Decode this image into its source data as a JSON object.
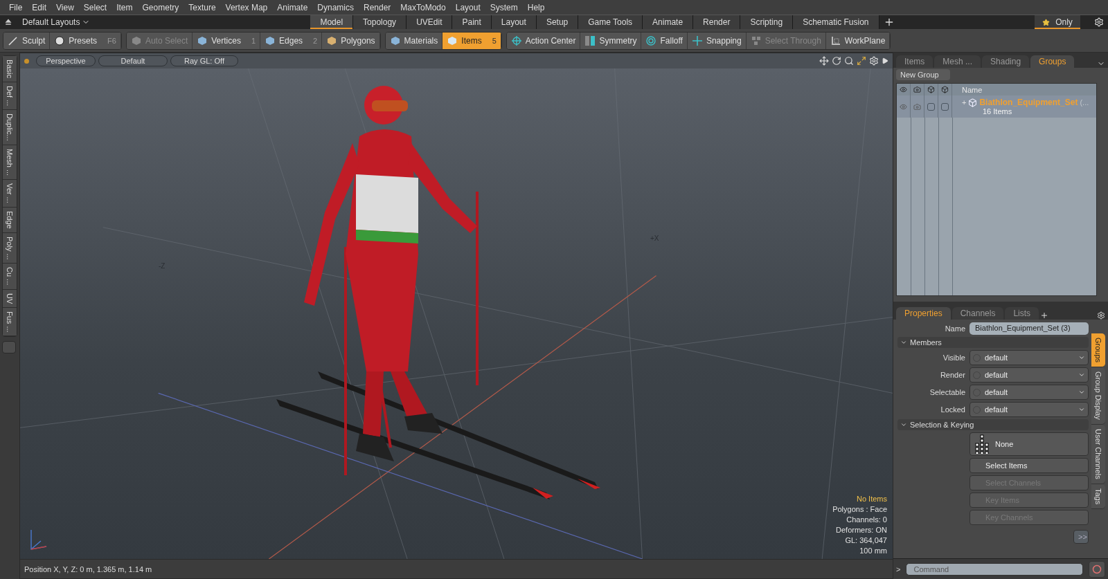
{
  "menu": [
    "File",
    "Edit",
    "View",
    "Select",
    "Item",
    "Geometry",
    "Texture",
    "Vertex Map",
    "Animate",
    "Dynamics",
    "Render",
    "MaxToModo",
    "Layout",
    "System",
    "Help"
  ],
  "layout_bar": {
    "layout_menu": "Default Layouts",
    "tabs": [
      {
        "label": "Model",
        "selected": true
      },
      {
        "label": "Topology",
        "selected": false
      },
      {
        "label": "UVEdit",
        "selected": false
      },
      {
        "label": "Paint",
        "selected": false
      },
      {
        "label": "Layout",
        "selected": false
      },
      {
        "label": "Setup",
        "selected": false
      },
      {
        "label": "Game Tools",
        "selected": false
      },
      {
        "label": "Animate",
        "selected": false
      },
      {
        "label": "Render",
        "selected": false
      },
      {
        "label": "Scripting",
        "selected": false
      },
      {
        "label": "Schematic Fusion",
        "selected": false
      }
    ],
    "only_button": "Only"
  },
  "toolbar": {
    "groups": [
      [
        {
          "label": "Sculpt",
          "selected": false,
          "disabled": false
        },
        {
          "label": "Presets",
          "shortcut": "F6",
          "selected": false,
          "disabled": false
        }
      ],
      [
        {
          "label": "Auto Select",
          "selected": false,
          "disabled": true
        },
        {
          "label": "Vertices",
          "shortcut": "1",
          "selected": false,
          "disabled": false
        },
        {
          "label": "Edges",
          "shortcut": "2",
          "selected": false,
          "disabled": false
        },
        {
          "label": "Polygons",
          "selected": false,
          "disabled": false
        }
      ],
      [
        {
          "label": "Materials",
          "selected": false,
          "disabled": false
        },
        {
          "label": "Items",
          "shortcut": "5",
          "selected": true,
          "disabled": false
        }
      ],
      [
        {
          "label": "Action Center",
          "selected": false,
          "disabled": false
        },
        {
          "label": "Symmetry",
          "selected": false,
          "disabled": false
        },
        {
          "label": "Falloff",
          "selected": false,
          "disabled": false
        },
        {
          "label": "Snapping",
          "selected": false,
          "disabled": false
        },
        {
          "label": "Select Through",
          "selected": false,
          "disabled": true
        },
        {
          "label": "WorkPlane",
          "selected": false,
          "disabled": false
        }
      ]
    ]
  },
  "left_tabs": [
    "Basic",
    "Def ...",
    "Duplic...",
    "Mesh ...",
    "Ver ...",
    "Edge",
    "Poly ...",
    "Cu ...",
    "UV",
    "Fus ..."
  ],
  "viewport": {
    "header_buttons": [
      "Perspective",
      "Default",
      "Ray GL: Off"
    ],
    "axis_labels": [
      "-Z",
      "+X"
    ],
    "info": [
      {
        "text": "No Items",
        "highlighted": true
      },
      {
        "text": "Polygons : Face",
        "highlighted": false
      },
      {
        "text": "Channels: 0",
        "highlighted": false
      },
      {
        "text": "Deformers: ON",
        "highlighted": false
      },
      {
        "text": "GL: 364,047",
        "highlighted": false
      },
      {
        "text": "100 mm",
        "highlighted": false
      }
    ],
    "status": "Position X, Y, Z:  0 m, 1.365 m, 1.14 m"
  },
  "groups_panel": {
    "tabs": [
      {
        "label": "Items",
        "selected": false
      },
      {
        "label": "Mesh ...",
        "selected": false
      },
      {
        "label": "Shading",
        "selected": false
      },
      {
        "label": "Groups",
        "selected": true
      }
    ],
    "new_group": "New Group",
    "name_column": "Name",
    "rows": [
      {
        "name": "Biathlon_Equipment_Set",
        "suffix": "(...",
        "count": "16 Items",
        "expander": "+",
        "flags": [
          {
            "checked": false
          },
          {
            "checked": false
          }
        ]
      }
    ]
  },
  "properties": {
    "tabs": [
      {
        "label": "Properties",
        "selected": true
      },
      {
        "label": "Channels",
        "selected": false
      },
      {
        "label": "Lists",
        "selected": false
      }
    ],
    "name_label": "Name",
    "name_value": "Biathlon_Equipment_Set (3)",
    "members_title": "Members",
    "members": [
      {
        "label": "Visible",
        "value": "default"
      },
      {
        "label": "Render",
        "value": "default"
      },
      {
        "label": "Selectable",
        "value": "default"
      },
      {
        "label": "Locked",
        "value": "default"
      }
    ],
    "keying_title": "Selection & Keying",
    "none_button": "None",
    "actions": [
      {
        "label": "Select Items",
        "disabled": false
      },
      {
        "label": "Select Channels",
        "disabled": true
      },
      {
        "label": "Key Items",
        "disabled": true
      },
      {
        "label": "Key Channels",
        "disabled": true
      }
    ],
    "more_button": ">>",
    "side_tabs": [
      {
        "label": "Groups",
        "selected": true
      },
      {
        "label": "Group Display",
        "selected": false
      },
      {
        "label": "User Channels",
        "selected": false
      },
      {
        "label": "Tags",
        "selected": false
      }
    ]
  },
  "command": {
    "prompt": ">",
    "placeholder": "Command"
  }
}
